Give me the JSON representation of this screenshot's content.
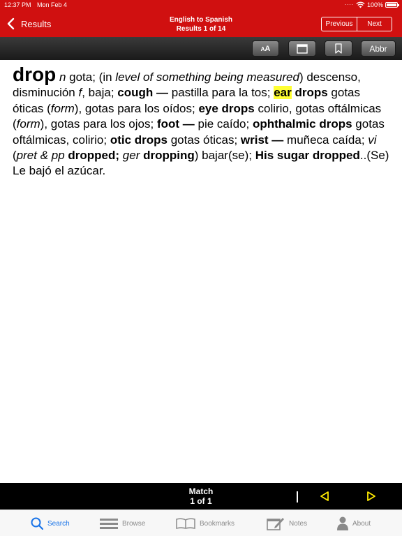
{
  "status_bar": {
    "time": "12:37 PM",
    "date": "Mon Feb 4",
    "dots": "....",
    "battery": "100%"
  },
  "nav": {
    "back_label": "Results",
    "title_line1": "English to Spanish",
    "title_line2": "Results 1 of 14",
    "previous_label": "Previous",
    "next_label": "Next"
  },
  "toolbar": {
    "font_size_label_big": "A",
    "font_size_label_small": "A",
    "abbr_label": "Abbr"
  },
  "entry": {
    "headword": "drop",
    "segments": [
      "n",
      " gota; (in ",
      "level of something being measured",
      ") descenso, disminución ",
      "f",
      ", baja; ",
      "cough",
      " — ",
      "pastilla para la tos; ",
      "ear",
      " ",
      "drops",
      " gotas óticas (",
      "form",
      "), gotas para los oídos; ",
      "eye drops",
      " colirio, gotas oftálmicas (",
      "form",
      "), gotas para los ojos; ",
      "foot",
      " — ",
      "pie caído; ",
      "ophthalmic drops",
      " gotas oftálmicas, colirio; ",
      "otic drops",
      " gotas óticas; ",
      "wrist",
      " — ",
      "muñeca caída; ",
      "vi",
      " (",
      "pret & pp",
      " ",
      "dropped;",
      " ",
      "ger",
      " ",
      "dropping",
      ") bajar(se); ",
      "His sugar dropped",
      "..(Se) Le bajó el azúcar."
    ]
  },
  "match_bar": {
    "label": "Match",
    "count": "1 of 1"
  },
  "tabs": [
    {
      "label": "Search",
      "icon": "search-icon",
      "active": true
    },
    {
      "label": "Browse",
      "icon": "browse-icon",
      "active": false
    },
    {
      "label": "Bookmarks",
      "icon": "book-icon",
      "active": false
    },
    {
      "label": "Notes",
      "icon": "notes-icon",
      "active": false
    },
    {
      "label": "About",
      "icon": "person-icon",
      "active": false
    }
  ],
  "colors": {
    "header_red": "#d01010",
    "highlight": "#ffff33",
    "tab_active": "#1a74e8",
    "arrow_yellow": "#ffea00"
  }
}
